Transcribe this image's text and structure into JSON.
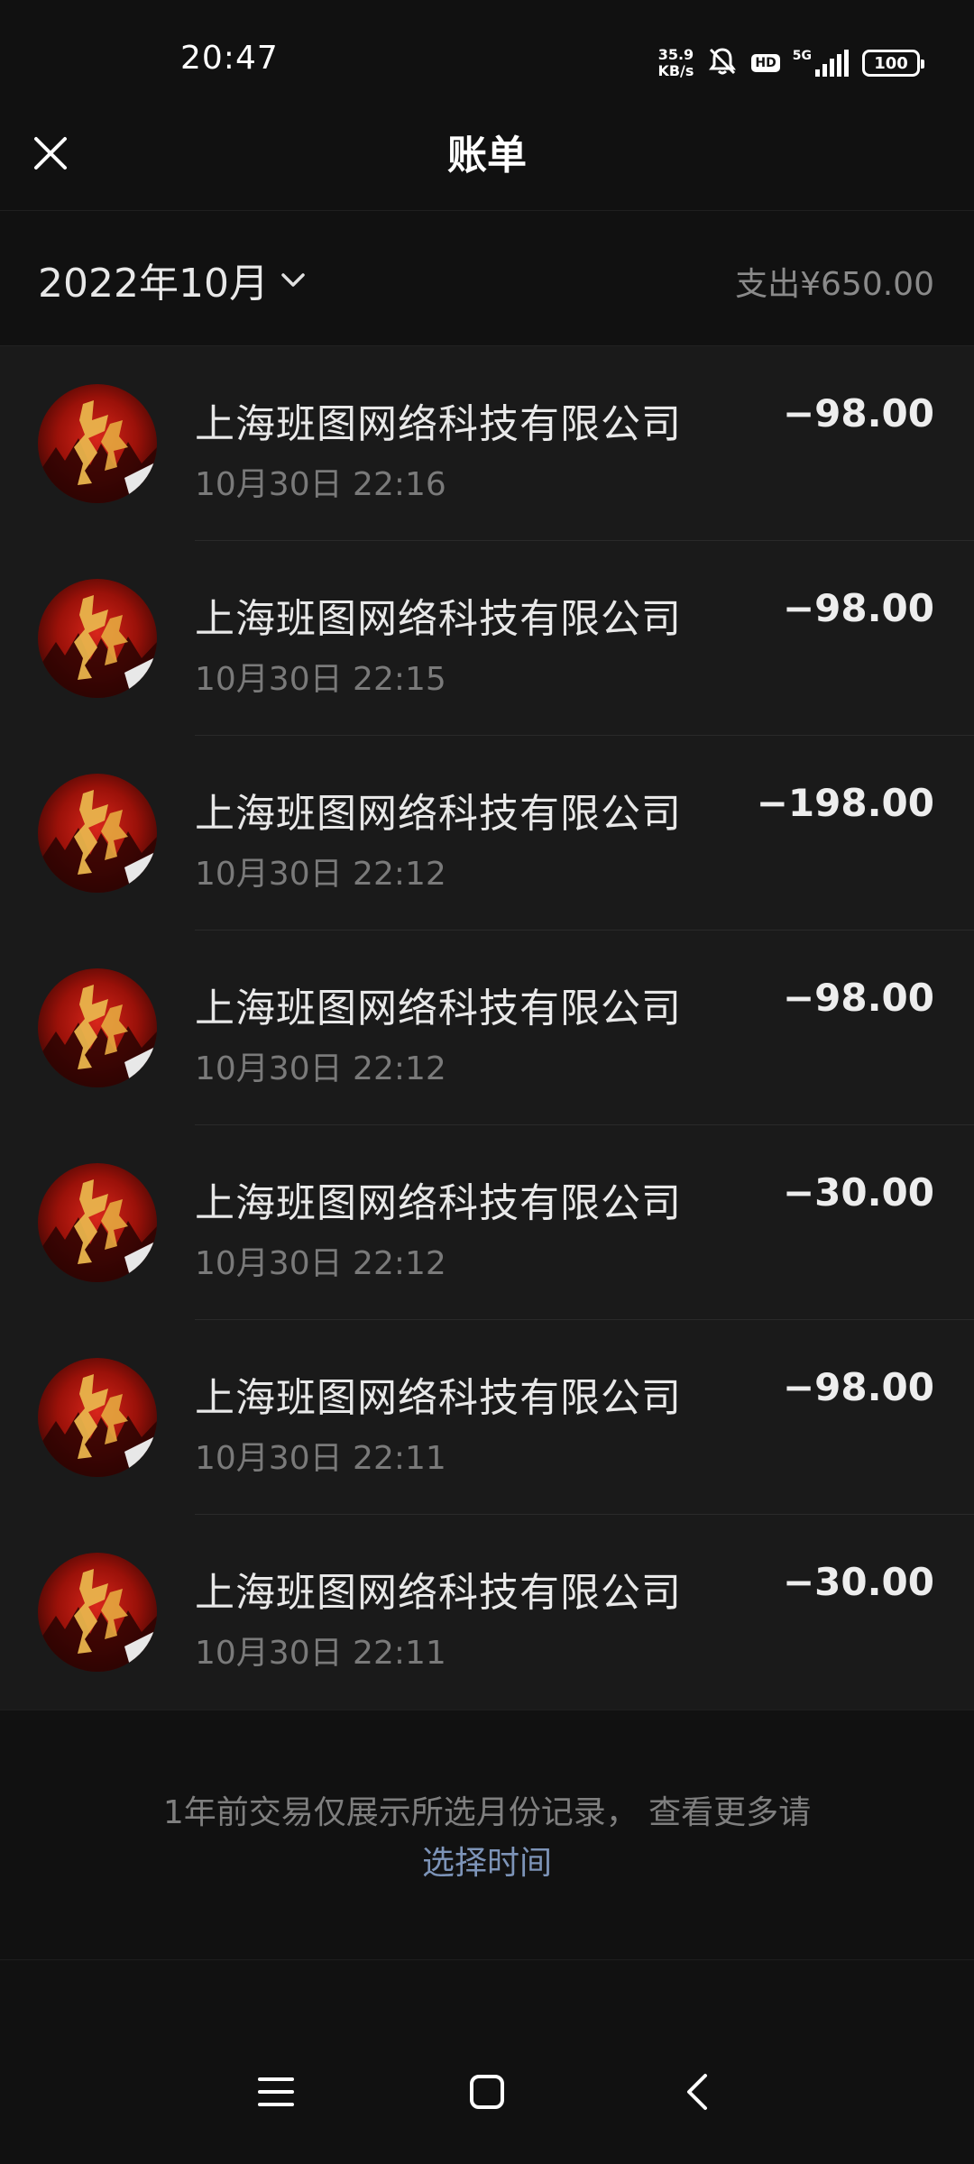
{
  "status_bar": {
    "time": "20:47",
    "net_speed_value": "35.9",
    "net_speed_unit": "KB/s",
    "hd": "HD",
    "network": "5G",
    "battery": "100"
  },
  "header": {
    "title": "账单",
    "close_icon": "close-icon"
  },
  "month_bar": {
    "month": "2022年10月",
    "total_spend": "支出¥650.00"
  },
  "transactions": [
    {
      "merchant": "上海班图网络科技有限公司",
      "time": "10月30日 22:16",
      "amount": "−98.00"
    },
    {
      "merchant": "上海班图网络科技有限公司",
      "time": "10月30日 22:15",
      "amount": "−98.00"
    },
    {
      "merchant": "上海班图网络科技有限公司",
      "time": "10月30日 22:12",
      "amount": "−198.00"
    },
    {
      "merchant": "上海班图网络科技有限公司",
      "time": "10月30日 22:12",
      "amount": "−98.00"
    },
    {
      "merchant": "上海班图网络科技有限公司",
      "time": "10月30日 22:12",
      "amount": "−30.00"
    },
    {
      "merchant": "上海班图网络科技有限公司",
      "time": "10月30日 22:11",
      "amount": "−98.00"
    },
    {
      "merchant": "上海班图网络科技有限公司",
      "time": "10月30日 22:11",
      "amount": "−30.00"
    }
  ],
  "footer": {
    "note": "1年前交易仅展示所选月份记录， 查看更多请",
    "link": "选择时间"
  },
  "colors": {
    "background": "#111111",
    "list_background": "#1a1a1a",
    "link": "#7d94b8",
    "avatar_red": "#d8261b"
  },
  "nav_icons": [
    "menu-icon",
    "home-icon",
    "back-icon"
  ]
}
